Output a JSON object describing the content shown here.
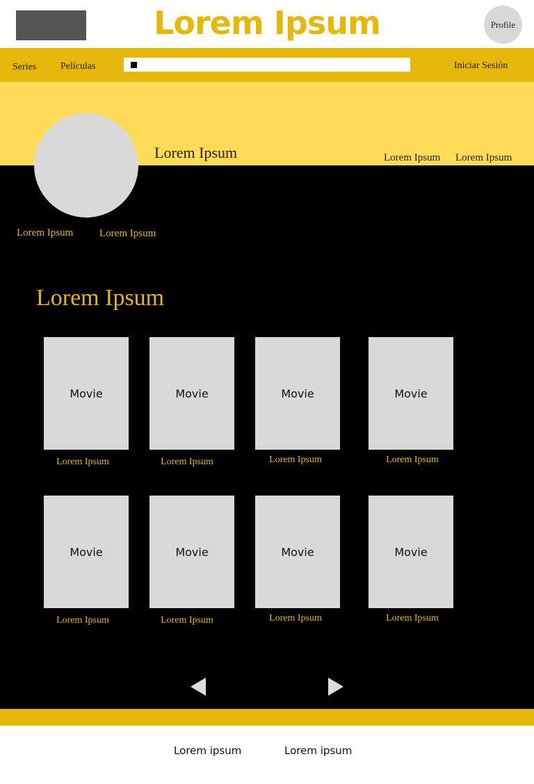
{
  "header": {
    "site_title": "Lorem Ipsum",
    "profile_label": "Profile"
  },
  "nav": {
    "series": "Series",
    "peliculas": "Películas",
    "login": "Iniciar Sesión"
  },
  "banner": {
    "name": "Lorem Ipsum",
    "right_link_1": "Lorem Ipsum",
    "right_link_2": "Lorem Ipsum",
    "under_link_1": "Lorem Ipsum",
    "under_link_2": "Lorem Ipsum"
  },
  "section": {
    "title": "Lorem Ipsum"
  },
  "movies": [
    {
      "label": "Movie",
      "caption": "Lorem Ipsum"
    },
    {
      "label": "Movie",
      "caption": "Lorem Ipsum"
    },
    {
      "label": "Movie",
      "caption": "Lorem Ipsum"
    },
    {
      "label": "Movie",
      "caption": "Lorem Ipsum"
    },
    {
      "label": "Movie",
      "caption": "Lorem Ipsum"
    },
    {
      "label": "Movie",
      "caption": "Lorem Ipsum"
    },
    {
      "label": "Movie",
      "caption": "Lorem Ipsum"
    },
    {
      "label": "Movie",
      "caption": "Lorem Ipsum"
    }
  ],
  "footer": {
    "link_1": "Lorem ipsum",
    "link_2": "Lorem ipsum"
  }
}
